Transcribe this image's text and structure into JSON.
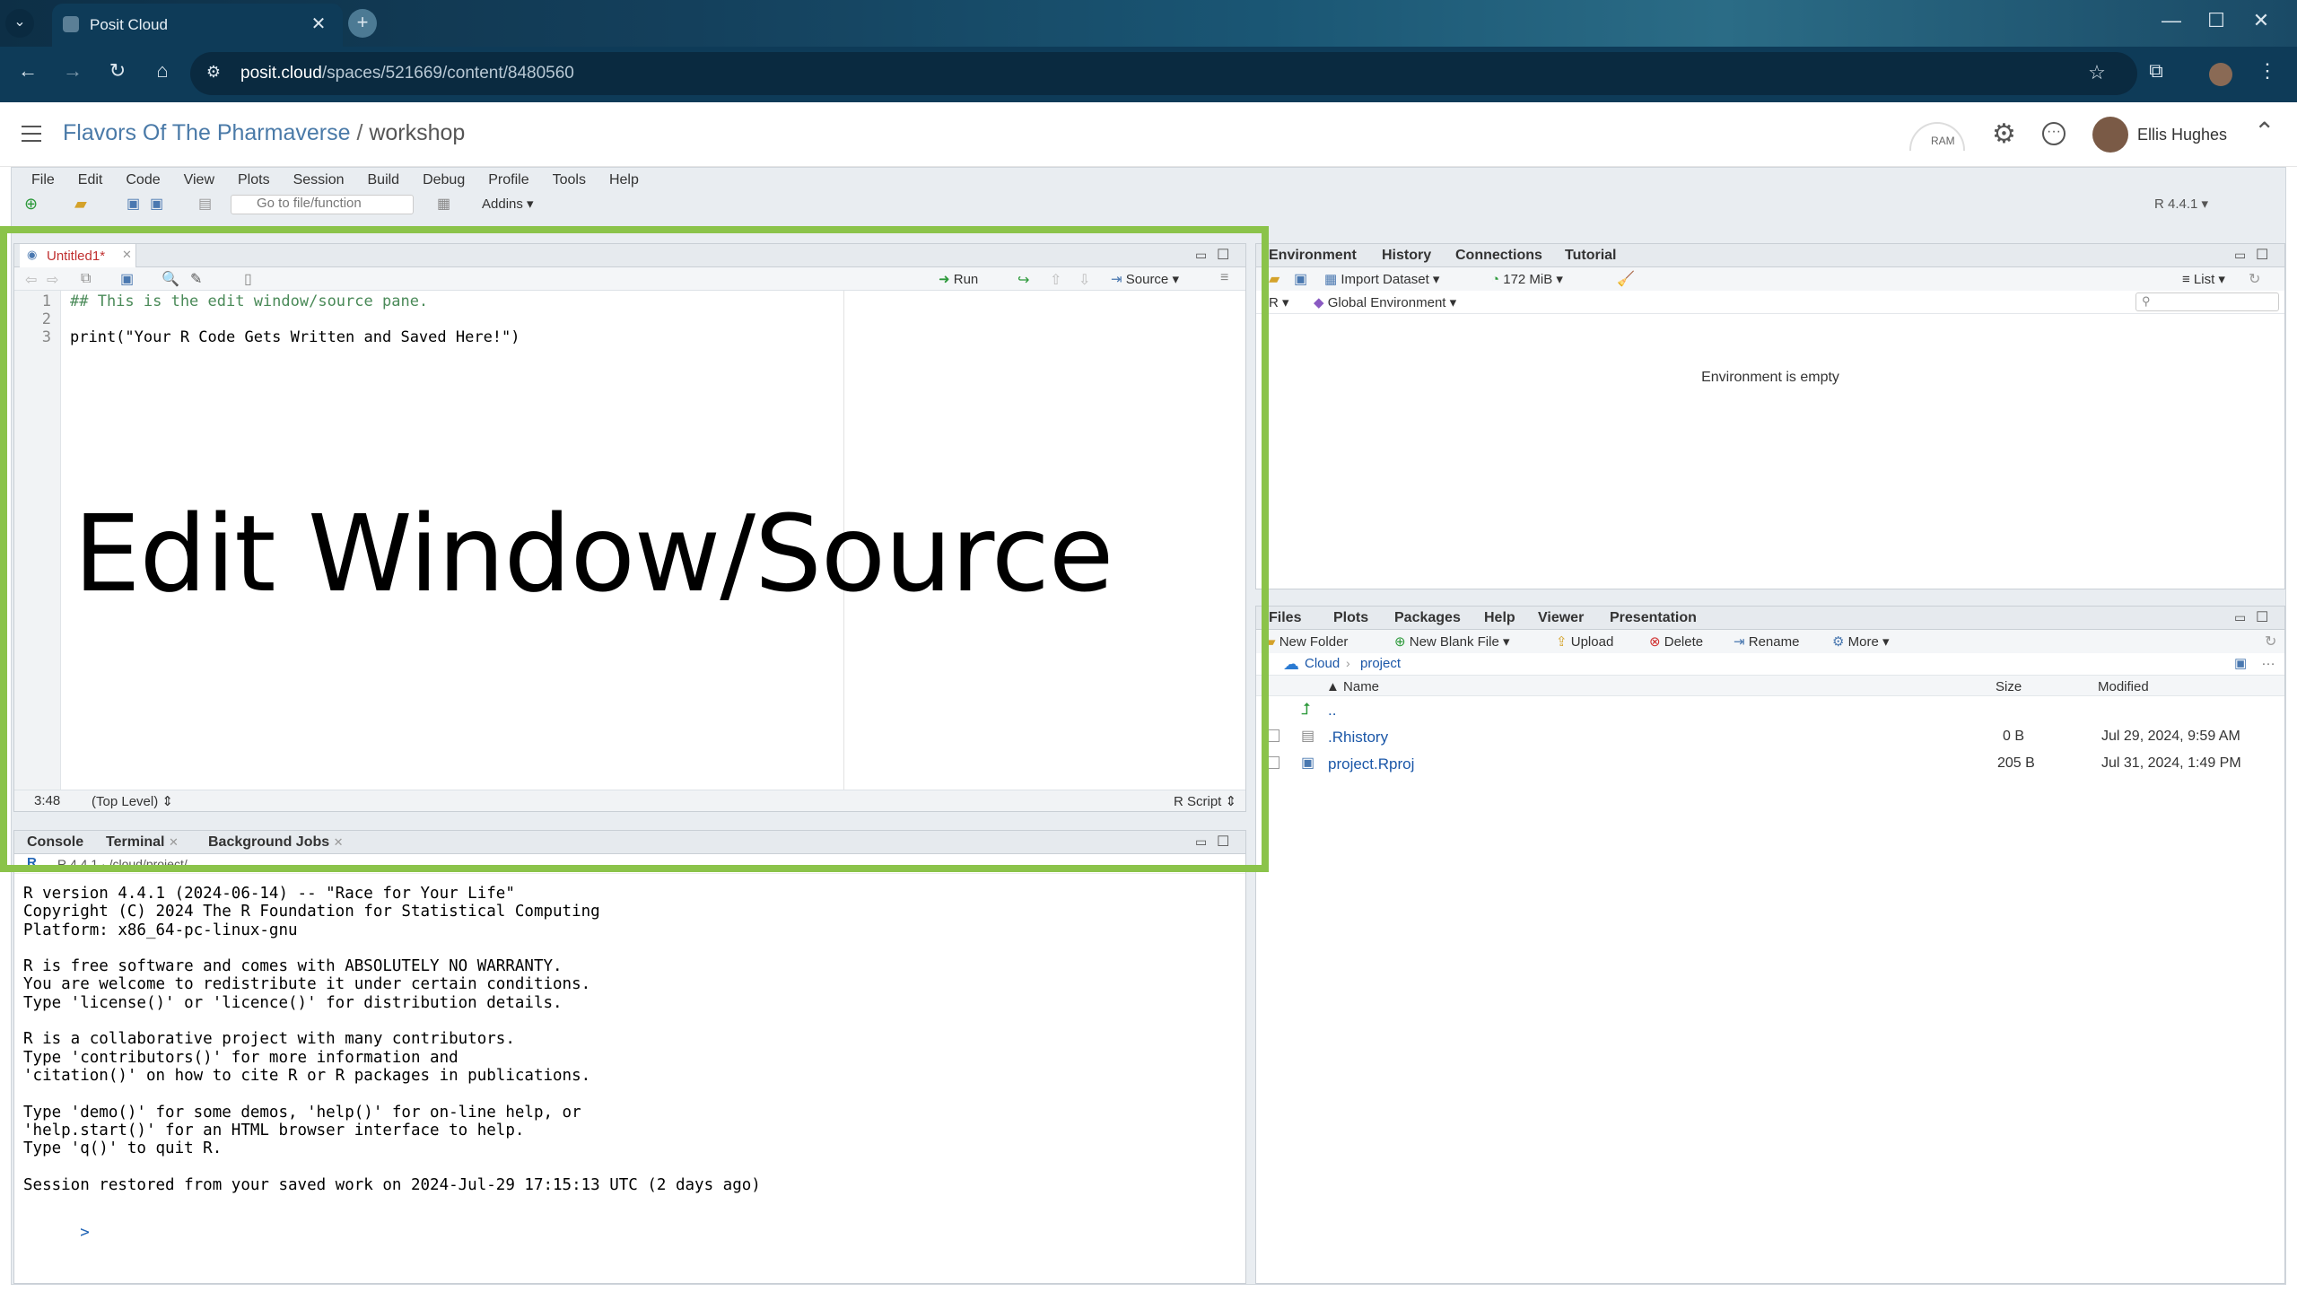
{
  "browser": {
    "tab_title": "Posit Cloud",
    "url_host": "posit.cloud",
    "url_path": "/spaces/521669/content/8480560"
  },
  "posit": {
    "breadcrumb_space": "Flavors Of The Pharmaverse",
    "breadcrumb_sep": "/",
    "breadcrumb_project": "workshop",
    "ram_label": "RAM",
    "user_name": "Ellis Hughes"
  },
  "ide": {
    "menu": [
      "File",
      "Edit",
      "Code",
      "View",
      "Plots",
      "Session",
      "Build",
      "Debug",
      "Profile",
      "Tools",
      "Help"
    ],
    "goto_placeholder": "Go to file/function",
    "addins": "Addins",
    "r_version": "R 4.4.1"
  },
  "source": {
    "tab": "Untitled1*",
    "run": "Run",
    "source_btn": "Source",
    "lines": [
      "1",
      "2",
      "3"
    ],
    "code": [
      "## This is the edit window/source pane.",
      "",
      "print(\"Your R Code Gets Written and Saved Here!\")"
    ],
    "cursor_pos": "3:48",
    "scope": "(Top Level)",
    "file_type": "R Script",
    "overlay_label": "Edit Window/Source"
  },
  "console": {
    "tabs": [
      "Console",
      "Terminal",
      "Background Jobs"
    ],
    "path": "R 4.4.1 · /cloud/project/",
    "text": "R version 4.4.1 (2024-06-14) -- \"Race for Your Life\"\nCopyright (C) 2024 The R Foundation for Statistical Computing\nPlatform: x86_64-pc-linux-gnu\n\nR is free software and comes with ABSOLUTELY NO WARRANTY.\nYou are welcome to redistribute it under certain conditions.\nType 'license()' or 'licence()' for distribution details.\n\nR is a collaborative project with many contributors.\nType 'contributors()' for more information and\n'citation()' on how to cite R or R packages in publications.\n\nType 'demo()' for some demos, 'help()' for on-line help, or\n'help.start()' for an HTML browser interface to help.\nType 'q()' to quit R.\n\nSession restored from your saved work on 2024-Jul-29 17:15:13 UTC (2 days ago)",
    "prompt": ">"
  },
  "environment": {
    "tabs": [
      "Environment",
      "History",
      "Connections",
      "Tutorial"
    ],
    "import_dataset": "Import Dataset",
    "memory": "172 MiB",
    "list_view": "List",
    "lang": "R",
    "scope": "Global Environment",
    "empty_msg": "Environment is empty"
  },
  "files": {
    "tabs": [
      "Files",
      "Plots",
      "Packages",
      "Help",
      "Viewer",
      "Presentation"
    ],
    "new_folder": "New Folder",
    "new_blank_file": "New Blank File",
    "upload": "Upload",
    "delete": "Delete",
    "rename": "Rename",
    "more": "More",
    "path_root": "Cloud",
    "path_project": "project",
    "col_name": "Name",
    "col_size": "Size",
    "col_modified": "Modified",
    "up_dir": "..",
    "rows": [
      {
        "name": ".Rhistory",
        "size": "0 B",
        "modified": "Jul 29, 2024, 9:59 AM"
      },
      {
        "name": "project.Rproj",
        "size": "205 B",
        "modified": "Jul 31, 2024, 1:49 PM"
      }
    ]
  },
  "colors": {
    "highlight": "#8bc34a",
    "link_blue": "#1b57a8",
    "browser_bg": "#0e3b58"
  }
}
